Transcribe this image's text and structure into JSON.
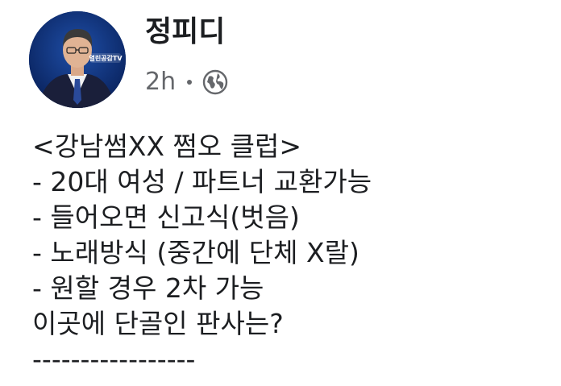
{
  "post": {
    "author": "정피디",
    "time": "2h",
    "avatar_badge": "열린공감TV",
    "privacy_icon": "globe-icon",
    "lines": [
      "<강남썸XX 쩜오 클럽>",
      "- 20대 여성 / 파트너 교환가능",
      "- 들어오면 신고식(벗음)",
      "- 노래방식 (중간에 단체 X랄)",
      "- 원할 경우 2차 가능",
      "이곳에 단골인 판사는?",
      "-----------------"
    ]
  },
  "colors": {
    "text": "#1c1e21",
    "meta": "#65676b",
    "avatar_bg": "#0b2a6b"
  }
}
